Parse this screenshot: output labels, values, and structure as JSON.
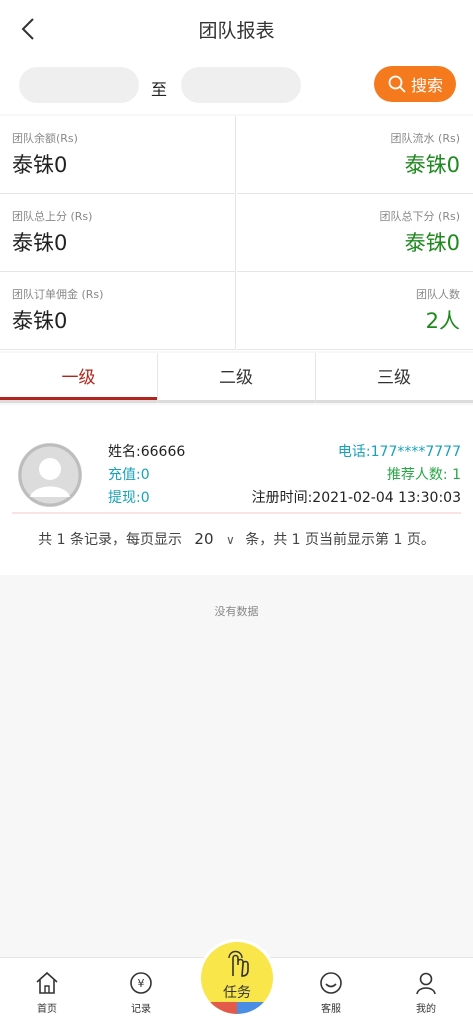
{
  "header": {
    "title": "团队报表"
  },
  "search": {
    "start_placeholder": "",
    "to_label": "至",
    "end_placeholder": "",
    "button_label": "搜索"
  },
  "stats": [
    {
      "label": "团队余额(Rs)",
      "value": "泰铢0"
    },
    {
      "label": "团队流水 (Rs)",
      "value": "泰铢0"
    },
    {
      "label": "团队总上分 (Rs)",
      "value": "泰铢0"
    },
    {
      "label": "团队总下分 (Rs)",
      "value": "泰铢0"
    },
    {
      "label": "团队订单佣金 (Rs)",
      "value": "泰铢0"
    },
    {
      "label": "团队人数",
      "value": "2人"
    }
  ],
  "tabs": [
    {
      "label": "一级",
      "active": true
    },
    {
      "label": "二级",
      "active": false
    },
    {
      "label": "三级",
      "active": false
    }
  ],
  "member": {
    "name": "姓名:66666",
    "recharge": "充值:0",
    "withdraw": "提现:0",
    "phone": "电话:177****7777",
    "referrals": "推荐人数: 1",
    "register_time": "注册时间:2021-02-04 13:30:03"
  },
  "pager": {
    "prefix": "共 1 条记录，每页显示",
    "page_size": "20",
    "suffix": "条，共 1 页当前显示第 1 页。"
  },
  "empty_text": "没有数据",
  "nav": {
    "home": "首页",
    "records": "记录",
    "task": "任务",
    "service": "客服",
    "mine": "我的"
  },
  "colors": {
    "accent": "#f57a1e",
    "tab_active": "#b1261c",
    "positive": "#1d8a1d",
    "info": "#17a2b8",
    "success": "#28a745"
  }
}
